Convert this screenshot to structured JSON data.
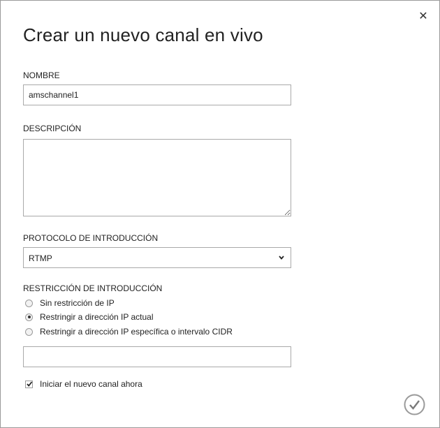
{
  "dialog": {
    "title": "Crear un nuevo canal en vivo",
    "close_icon": "close-icon",
    "confirm_icon": "checkmark-circle-icon"
  },
  "name_field": {
    "label": "NOMBRE",
    "value": "amschannel1"
  },
  "description_field": {
    "label": "DESCRIPCIÓN",
    "value": ""
  },
  "protocol_field": {
    "label": "PROTOCOLO DE INTRODUCCIÓN",
    "selected": "RTMP"
  },
  "restriction": {
    "label": "RESTRICCIÓN DE INTRODUCCIÓN",
    "options": [
      {
        "label": "Sin restricción de IP",
        "selected": false
      },
      {
        "label": "Restringir a dirección IP actual",
        "selected": true
      },
      {
        "label": "Restringir a dirección IP específica o intervalo CIDR",
        "selected": false
      }
    ],
    "ip_value": ""
  },
  "start_now": {
    "label": "Iniciar el nuevo canal ahora",
    "checked": true
  },
  "colors": {
    "border": "#a9a9a9",
    "text": "#222222",
    "confirm_icon": "#9a9a9a"
  }
}
